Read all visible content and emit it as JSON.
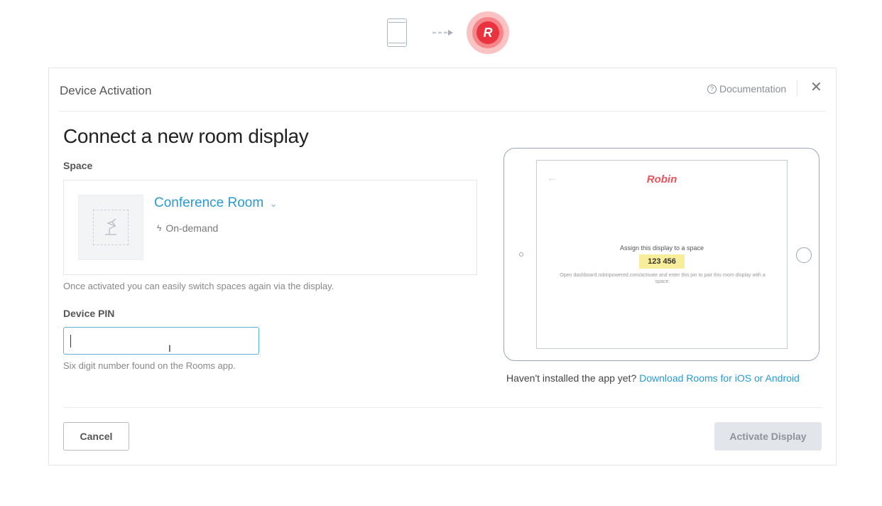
{
  "top": {
    "tablet_icon": "tablet-icon",
    "arrow_icon": "dashed-arrow-icon",
    "logo_letter": "R"
  },
  "modal": {
    "title": "Device Activation",
    "documentation_label": "Documentation",
    "close_icon": "close-icon"
  },
  "form": {
    "heading": "Connect a new room display",
    "space_label": "Space",
    "space": {
      "name": "Conference Room",
      "type": "On-demand",
      "thumbnail_icon": "lamp-icon"
    },
    "space_help": "Once activated you can easily switch spaces again via the display.",
    "pin_label": "Device PIN",
    "pin_value": "",
    "pin_help": "Six digit number found on the Rooms app."
  },
  "preview": {
    "brand": "Robin",
    "assign_text": "Assign this display to a space",
    "pin": "123 456",
    "instructions": "Open dashboard.robinpowered.com/activate and enter this pin to pair this room display with a space."
  },
  "install": {
    "prompt": "Haven't installed the app yet?",
    "link": "Download Rooms for iOS or Android"
  },
  "footer": {
    "cancel_label": "Cancel",
    "activate_label": "Activate Display"
  },
  "colors": {
    "link_blue": "#2a9ad0",
    "brand_red": "#e9343f",
    "pin_highlight": "#f8ed9a",
    "input_focus": "#5fb1e0"
  }
}
